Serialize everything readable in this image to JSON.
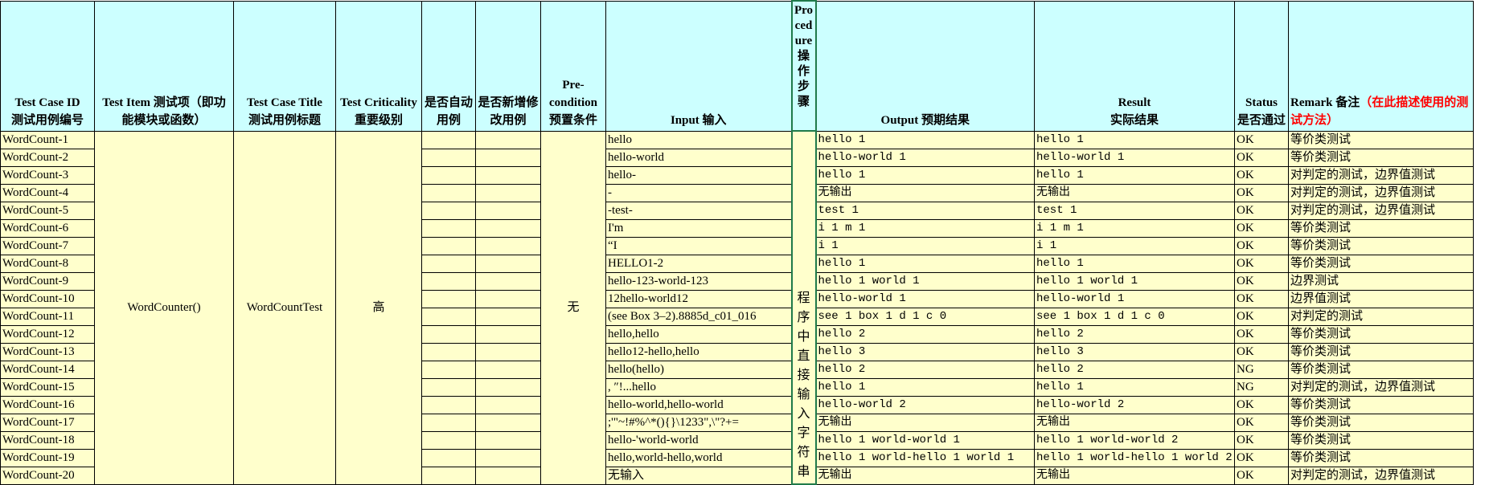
{
  "headers": {
    "id_en": "Test Case ID",
    "id_cn": "测试用例编号",
    "item_en": "Test Item",
    "item_cn": "测试项（即功能模块或函数）",
    "title_en": "Test Case Title",
    "title_cn": "测试用例标题",
    "crit_en": "Test Criticality",
    "crit_cn": "重要级别",
    "auto": "是否自动用例",
    "modified": "是否新增修改用例",
    "pre_en": "Pre-condition",
    "pre_cn": "预置条件",
    "input": "Input 输入",
    "procedure_en": "Procedure",
    "procedure_cn": "操作步骤",
    "output": "Output 预期结果",
    "result_en": "Result",
    "result_cn": "实际结果",
    "status_en": "Status",
    "status_cn": "是否通过",
    "remark_en": "Remark 备注",
    "remark_cn": "（在此描述使用的测试方法）"
  },
  "merged": {
    "test_item": "WordCounter()",
    "test_title": "WordCountTest",
    "criticality": "高",
    "precondition": "无",
    "procedure": "程序中直接输入字符串"
  },
  "rows": [
    {
      "id": "WordCount-1",
      "input": "hello",
      "output": "hello 1",
      "result": "hello 1",
      "status": "OK",
      "remark": "等价类测试"
    },
    {
      "id": "WordCount-2",
      "input": "hello-world",
      "output": "hello-world 1",
      "result": "hello-world 1",
      "status": "OK",
      "remark": "等价类测试"
    },
    {
      "id": "WordCount-3",
      "input": "hello-",
      "output": "hello 1",
      "result": "hello 1",
      "status": "OK",
      "remark": "对判定的测试，边界值测试"
    },
    {
      "id": "WordCount-4",
      "input": " -",
      "output": "无输出",
      "result": "无输出",
      "status": "OK",
      "remark": "对判定的测试，边界值测试"
    },
    {
      "id": "WordCount-5",
      "input": "-test-",
      "output": "test 1",
      "result": "test 1",
      "status": "OK",
      "remark": "对判定的测试，边界值测试"
    },
    {
      "id": "WordCount-6",
      "input": "I'm",
      "output": "i 1  m 1",
      "result": "i 1  m 1",
      "status": "OK",
      "remark": "等价类测试"
    },
    {
      "id": "WordCount-7",
      "input": "“I",
      "output": "i 1",
      "result": "i 1",
      "status": "OK",
      "remark": "等价类测试"
    },
    {
      "id": "WordCount-8",
      "input": "HELLO1-2",
      "output": "hello 1",
      "result": "hello 1",
      "status": "OK",
      "remark": "等价类测试"
    },
    {
      "id": "WordCount-9",
      "input": "hello-123-world-123",
      "output": "hello 1 world 1",
      "result": "hello 1 world 1",
      "status": "OK",
      "remark": "边界测试"
    },
    {
      "id": "WordCount-10",
      "input": "12hello-world12",
      "output": "hello-world 1",
      "result": "hello-world 1",
      "status": "OK",
      "remark": "边界值测试"
    },
    {
      "id": "WordCount-11",
      "input": "(see Box 3–2).8885d_c01_016",
      "output": "see 1  box 1  d 1  c 0",
      "result": "see 1  box 1  d 1  c 0",
      "status": "OK",
      "remark": "对判定的测试"
    },
    {
      "id": "WordCount-12",
      "input": "hello,hello",
      "output": "hello 2",
      "result": "hello 2",
      "status": "OK",
      "remark": "等价类测试"
    },
    {
      "id": "WordCount-13",
      "input": "hello12-hello,hello",
      "output": "hello 3",
      "result": "hello 3",
      "status": "OK",
      "remark": "等价类测试"
    },
    {
      "id": "WordCount-14",
      "input": "hello(hello)",
      "output": "hello 2",
      "result": "hello 2",
      "status": "NG",
      "remark": "等价类测试"
    },
    {
      "id": "WordCount-15",
      "input": ", ″!...hello",
      "output": "hello 1",
      "result": "hello 1",
      "status": "NG",
      "remark": "对判定的测试，边界值测试"
    },
    {
      "id": "WordCount-16",
      "input": "hello-world,hello-world",
      "output": "hello-world 2",
      "result": "hello-world 2",
      "status": "OK",
      "remark": "等价类测试"
    },
    {
      "id": "WordCount-17",
      "input": ";'\"~!#%^*(){}\\1233\",\\\"?+=",
      "output": "无输出",
      "result": "无输出",
      "status": "OK",
      "remark": "等价类测试"
    },
    {
      "id": "WordCount-18",
      "input": "hello-'world-world",
      "output": "hello 1 world-world 1",
      "result": "hello 1 world-world 2",
      "status": "OK",
      "remark": "等价类测试"
    },
    {
      "id": "WordCount-19",
      "input": "hello,world-hello,world",
      "output": "hello 1 world-hello 1 world 1",
      "result": "hello 1 world-hello 1 world 2",
      "status": "OK",
      "remark": "等价类测试"
    },
    {
      "id": "WordCount-20",
      "input": "无输入",
      "output": "无输出",
      "result": "无输出",
      "status": "OK",
      "remark": "对判定的测试，边界值测试"
    }
  ]
}
